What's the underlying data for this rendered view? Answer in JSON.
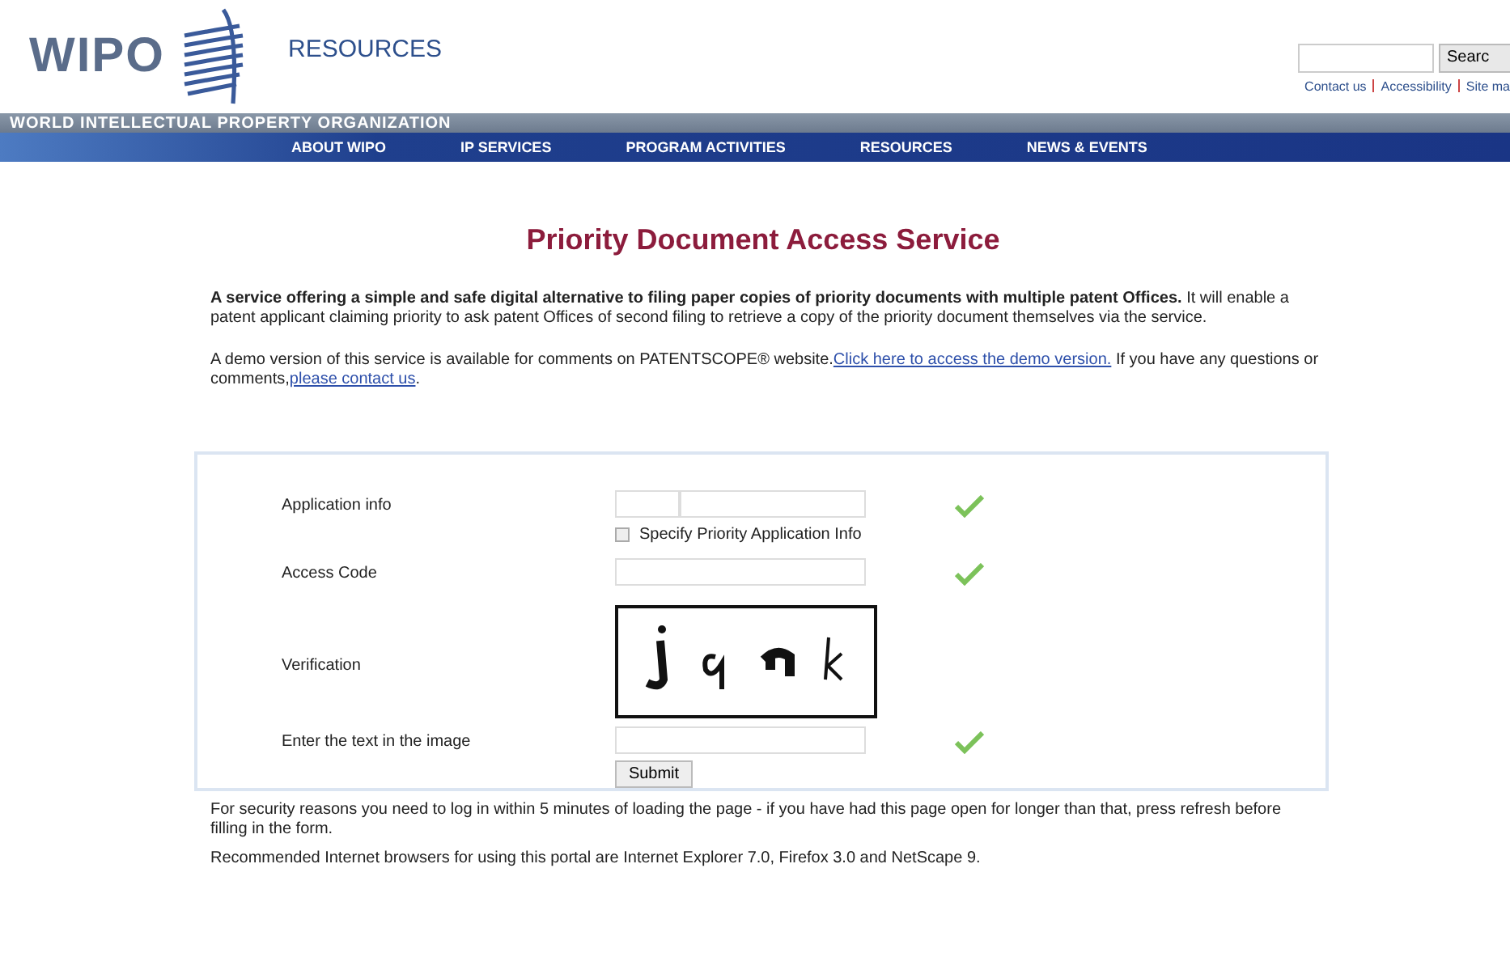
{
  "header": {
    "logo": "WIPO",
    "section": "RESOURCES",
    "search_button": "Searc",
    "links": [
      "Contact us",
      "Accessibility",
      "Site ma"
    ],
    "org_name": "WORLD INTELLECTUAL PROPERTY ORGANIZATION"
  },
  "nav": [
    "ABOUT WIPO",
    "IP SERVICES",
    "PROGRAM ACTIVITIES",
    "RESOURCES",
    "NEWS & EVENTS"
  ],
  "title": "Priority Document Access Service",
  "intro": "**A service offering a simple and safe digital alternative to filing paper copies of priority documents with multiple patent Offices.** It will enable a patent applicant claiming priority to ask patent Offices of second filing to retrieve a copy of the priority document themselves via the service.",
  "demo": {
    "before": "A demo version of this service is available for comments on PATENTSCOPE® website.",
    "link": "Click here to access the demo version.",
    "middle": " If you have any questions or comments,",
    "contact": "please contact us",
    "after": "."
  },
  "form": {
    "rows": [
      {
        "kind": "split",
        "label": "Application info",
        "valid": true
      },
      {
        "kind": "checkbox",
        "label": "Specify Priority Application Info",
        "checked": false
      },
      {
        "kind": "text",
        "label": "Access Code",
        "valid": true
      },
      {
        "kind": "captcha",
        "label": "Verification"
      },
      {
        "kind": "text",
        "label": "Enter the text in the image",
        "valid": true
      }
    ],
    "submit": "Submit"
  },
  "notes": [
    "For security reasons you need to log in within 5 minutes of loading the page - if you have had this page open for longer than that, press refresh before filling in the form.",
    "Recommended Internet browsers for using this portal are Internet Explorer 7.0, Firefox 3.0 and NetScape 9."
  ]
}
